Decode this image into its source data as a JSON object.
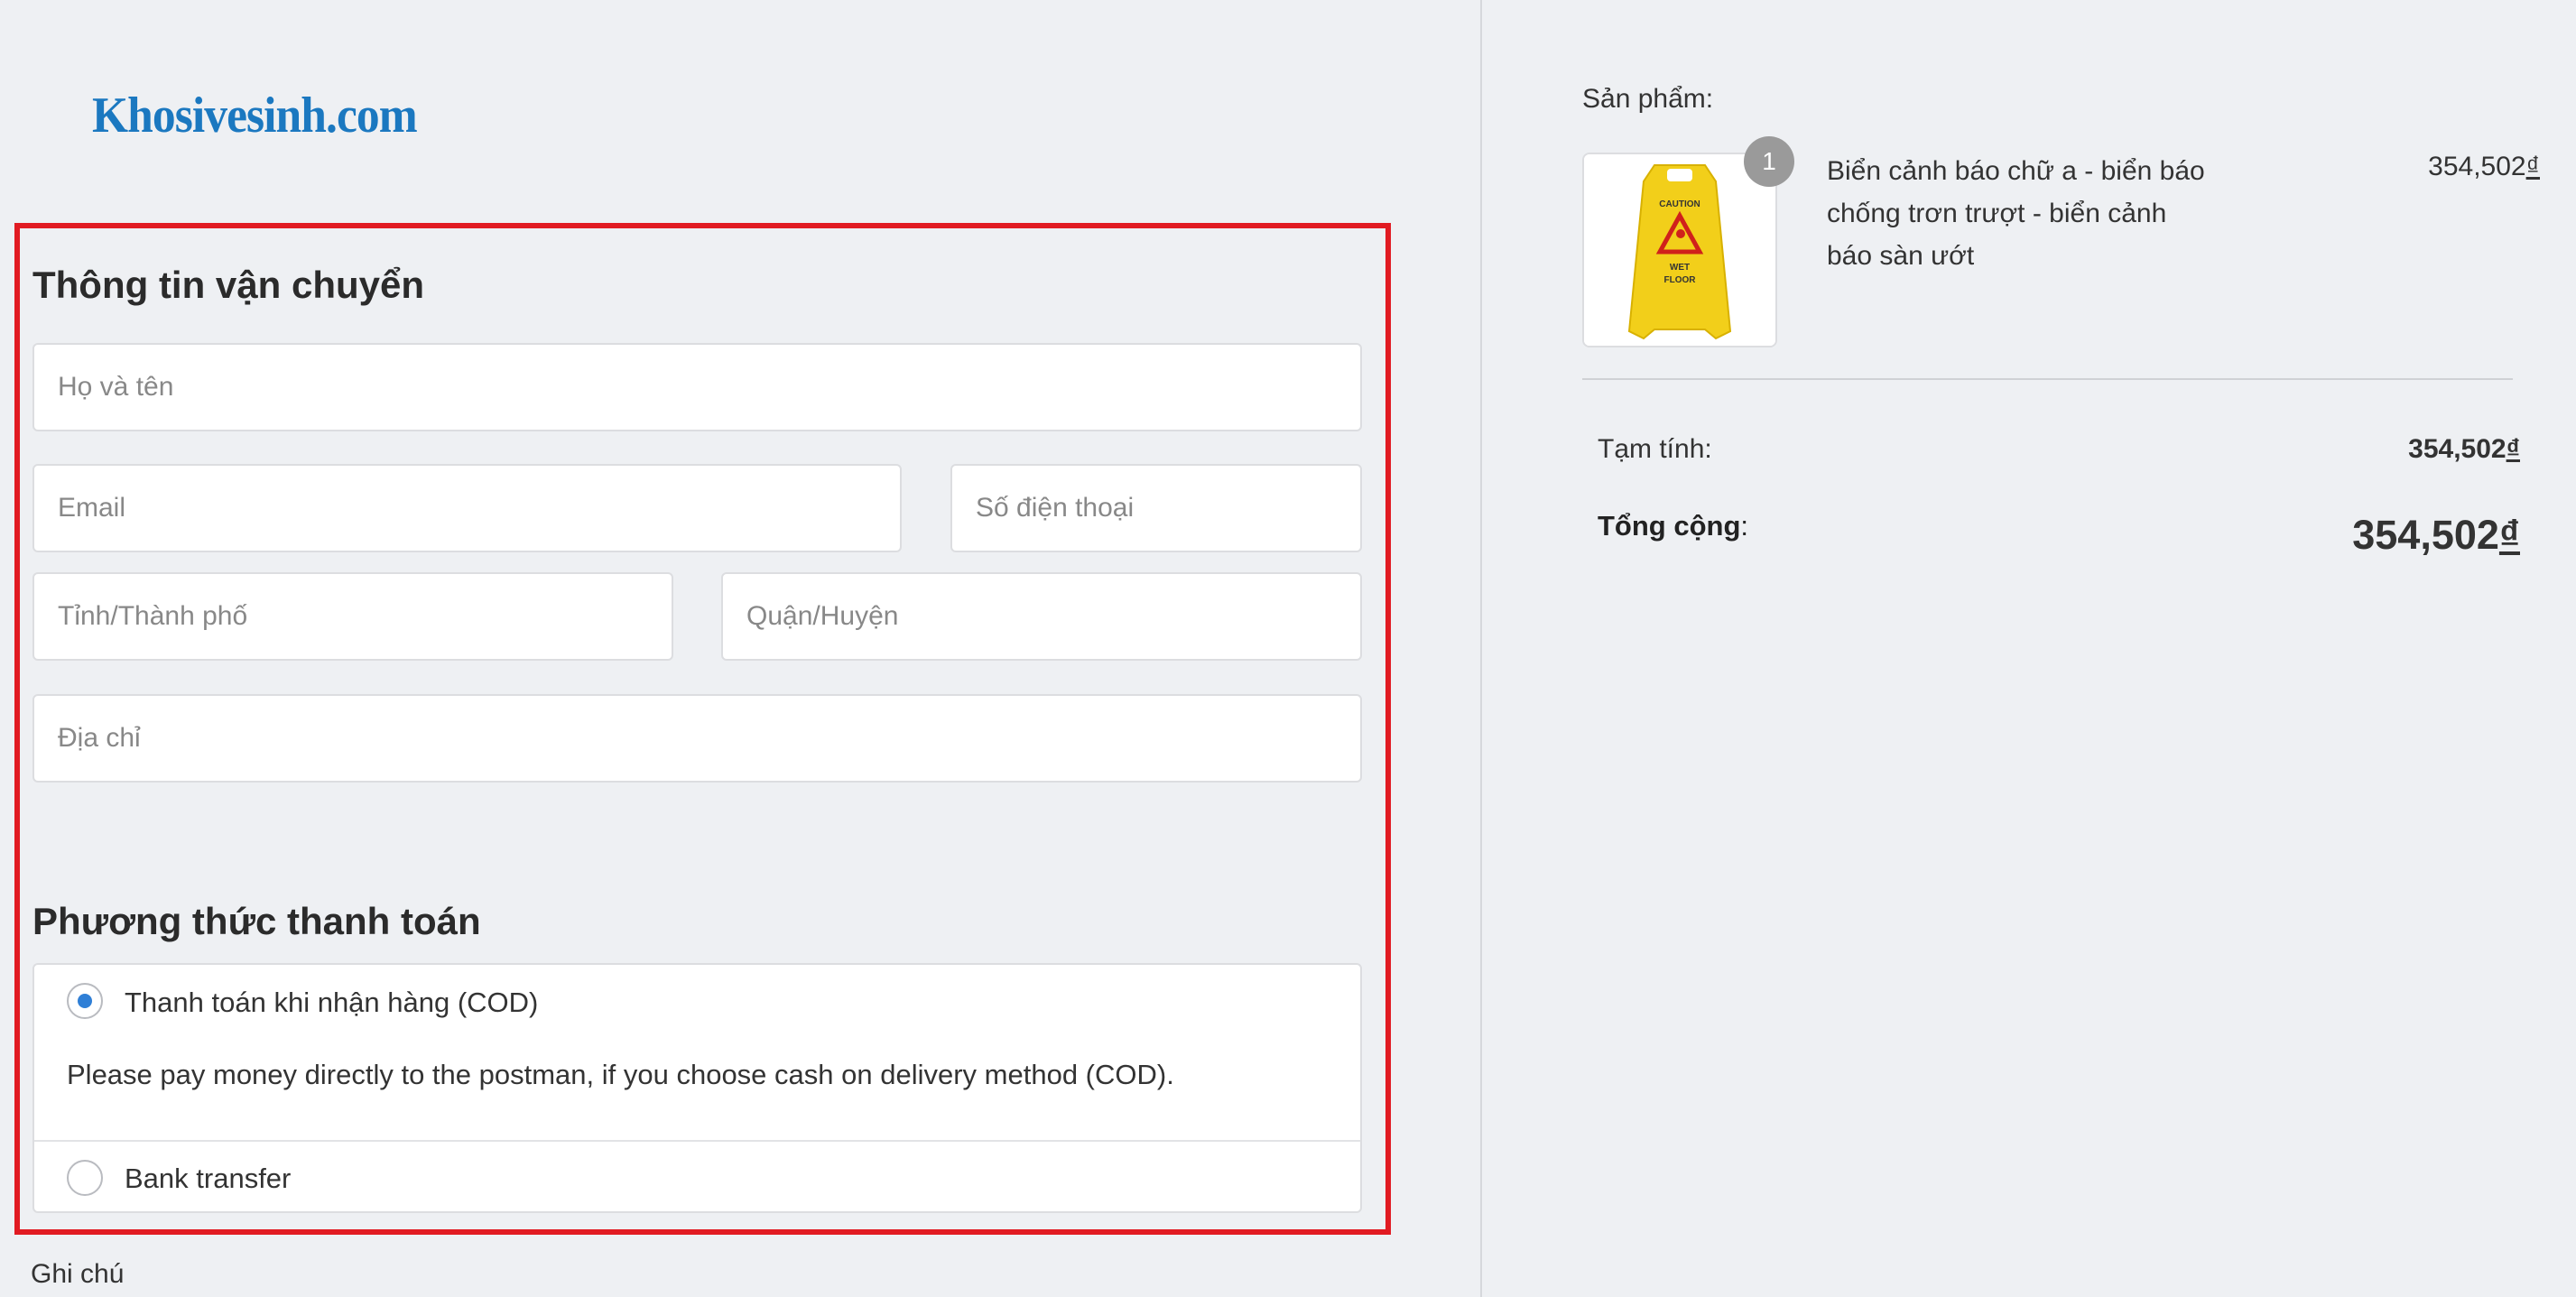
{
  "logo": {
    "text": "Khosivesinh.com"
  },
  "shipping": {
    "title": "Thông tin vận chuyển",
    "fields": {
      "fullname_placeholder": "Họ và tên",
      "email_placeholder": "Email",
      "phone_placeholder": "Số điện thoại",
      "city_placeholder": "Tỉnh/Thành phố",
      "district_placeholder": "Quận/Huyện",
      "address_placeholder": "Địa chỉ"
    }
  },
  "payment": {
    "title": "Phương thức thanh toán",
    "options": [
      {
        "label": "Thanh toán khi nhận hàng (COD)",
        "selected": true,
        "description": "Please pay money directly to the postman, if you choose cash on delivery method (COD)."
      },
      {
        "label": "Bank transfer",
        "selected": false
      }
    ]
  },
  "note_label": "Ghi chú",
  "cart": {
    "products_label": "Sản phẩm:",
    "item": {
      "quantity": "1",
      "name": "Biển cảnh báo chữ a - biển báo chống trơn trượt - biển cảnh báo sàn ướt",
      "price": "354,502",
      "currency": "₫",
      "image_sign_text": [
        "CAUTION",
        "WET",
        "FLOOR"
      ]
    },
    "subtotal_label": "Tạm tính:",
    "subtotal_value": "354,502",
    "total_label": "Tổng cộng",
    "total_colon": ":",
    "total_value": "354,502",
    "currency": "₫"
  },
  "colors": {
    "accent": "#2f7fd6",
    "highlight_border": "#e11b22",
    "logo": "#1b78c0",
    "background": "#eef0f3"
  }
}
